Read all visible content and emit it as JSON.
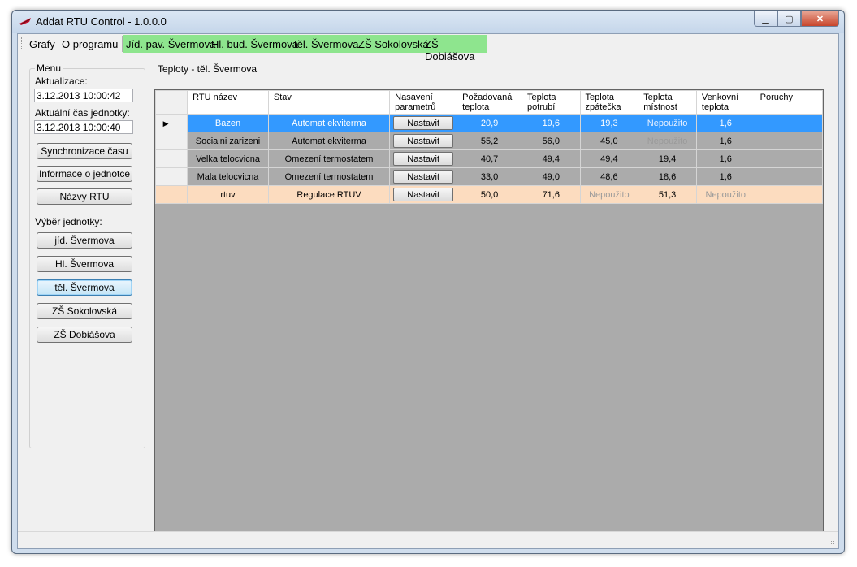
{
  "window": {
    "title": "Addat RTU Control - 1.0.0.0"
  },
  "menubar": {
    "items": [
      "Grafy",
      "O programu"
    ],
    "units": [
      "Jíd. pav. Švermova",
      "Hl. bud. Švermova",
      "těl. Švermova",
      "ZŠ Sokolovská",
      "ZŠ Dobiášova"
    ]
  },
  "menu_panel": {
    "title": "Menu",
    "update_label": "Aktualizace:",
    "update_value": "3.12.2013 10:00:42",
    "unit_time_label": "Aktuální čas jednotky:",
    "unit_time_value": "3.12.2013 10:00:40",
    "buttons": [
      "Synchronizace času",
      "Informace o jednotce",
      "Názvy RTU"
    ],
    "unit_select_label": "Výběr jednotky:",
    "unit_buttons": [
      "jíd. Švermova",
      "Hl. Švermova",
      "těl. Švermova",
      "ZŠ Sokolovská",
      "ZŠ Dobiášova"
    ],
    "active_unit": "těl. Švermova"
  },
  "group_title": "Teploty - těl. Švermova",
  "table": {
    "headers": [
      [
        "RTU název"
      ],
      [
        "Stav"
      ],
      [
        "Nasavení",
        "parametrů"
      ],
      [
        "Požadovaná",
        "teplota"
      ],
      [
        "Teplota",
        "potrubí"
      ],
      [
        "Teplota",
        "zpátečka"
      ],
      [
        "Teplota",
        "místnost"
      ],
      [
        "Venkovní",
        "teplota"
      ],
      [
        "Poruchy"
      ]
    ],
    "button_label": "Nastavit",
    "rows": [
      {
        "name": "Bazen",
        "state": "Automat ekviterma",
        "req": "20,9",
        "pipe": "19,6",
        "ret": "19,3",
        "room": "Nepoužito",
        "out": "1,6",
        "faults": "",
        "style": "selected"
      },
      {
        "name": "Socialni zarizeni",
        "state": "Automat ekviterma",
        "req": "55,2",
        "pipe": "56,0",
        "ret": "45,0",
        "room": "Nepoužito",
        "out": "1,6",
        "faults": "",
        "style": ""
      },
      {
        "name": "Velka telocvicna",
        "state": "Omezení termostatem",
        "req": "40,7",
        "pipe": "49,4",
        "ret": "49,4",
        "room": "19,4",
        "out": "1,6",
        "faults": "",
        "style": ""
      },
      {
        "name": "Mala telocvicna",
        "state": "Omezení termostatem",
        "req": "33,0",
        "pipe": "49,0",
        "ret": "48,6",
        "room": "18,6",
        "out": "1,6",
        "faults": "",
        "style": ""
      },
      {
        "name": "rtuv",
        "state": "Regulace RTUV",
        "req": "50,0",
        "pipe": "71,6",
        "ret": "Nepoužito",
        "room": "51,3",
        "out": "Nepoužito",
        "faults": "",
        "style": "orange"
      }
    ]
  }
}
